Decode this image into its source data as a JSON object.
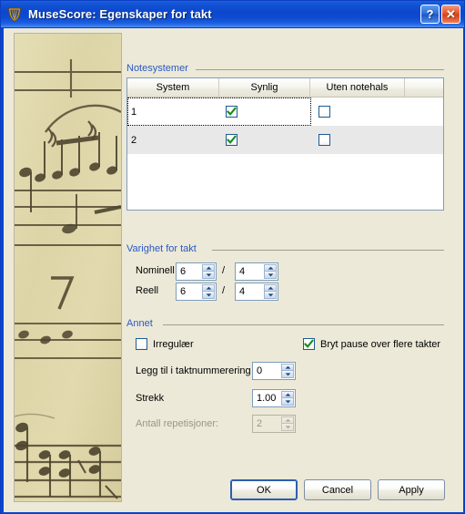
{
  "window": {
    "title": "MuseScore: Egenskaper for takt",
    "app_icon": "musescore-lyre-icon",
    "help_button": "?",
    "close_button": "✕"
  },
  "sheet_panel": {
    "alt": "vintage-sheet-music-manuscript"
  },
  "groups": {
    "staves": {
      "label": "Notesystemer"
    },
    "duration": {
      "label": "Varighet for takt"
    },
    "other": {
      "label": "Annet"
    }
  },
  "staff_table": {
    "columns": [
      "System",
      "Synlig",
      "Uten notehals",
      ""
    ],
    "rows": [
      {
        "system": "1",
        "visible": true,
        "stemless": false
      },
      {
        "system": "2",
        "visible": true,
        "stemless": false
      }
    ]
  },
  "duration": {
    "nominal_label": "Nominell",
    "nominal_numerator": "6",
    "nominal_denominator": "4",
    "actual_label": "Reell",
    "actual_numerator": "6",
    "actual_denominator": "4",
    "separator": "/"
  },
  "other": {
    "irregular_label": "Irregulær",
    "irregular_checked": false,
    "break_multimeasure_label": "Bryt pause over flere takter",
    "break_multimeasure_checked": true,
    "add_to_numbering_label": "Legg til i taktnummerering",
    "add_to_numbering_value": "0",
    "stretch_label": "Strekk",
    "stretch_value": "1.00",
    "repeat_count_label": "Antall repetisjoner:",
    "repeat_count_value": "2",
    "repeat_count_disabled": true
  },
  "buttons": {
    "ok": "OK",
    "cancel": "Cancel",
    "apply": "Apply"
  },
  "colors": {
    "titlebar_blue": "#0c48cd",
    "dialog_bg": "#ece9d8",
    "group_label": "#2a58c4",
    "check_green": "#1a8a1a",
    "field_border": "#7f9db9",
    "alt_row": "#e8e8e8"
  }
}
